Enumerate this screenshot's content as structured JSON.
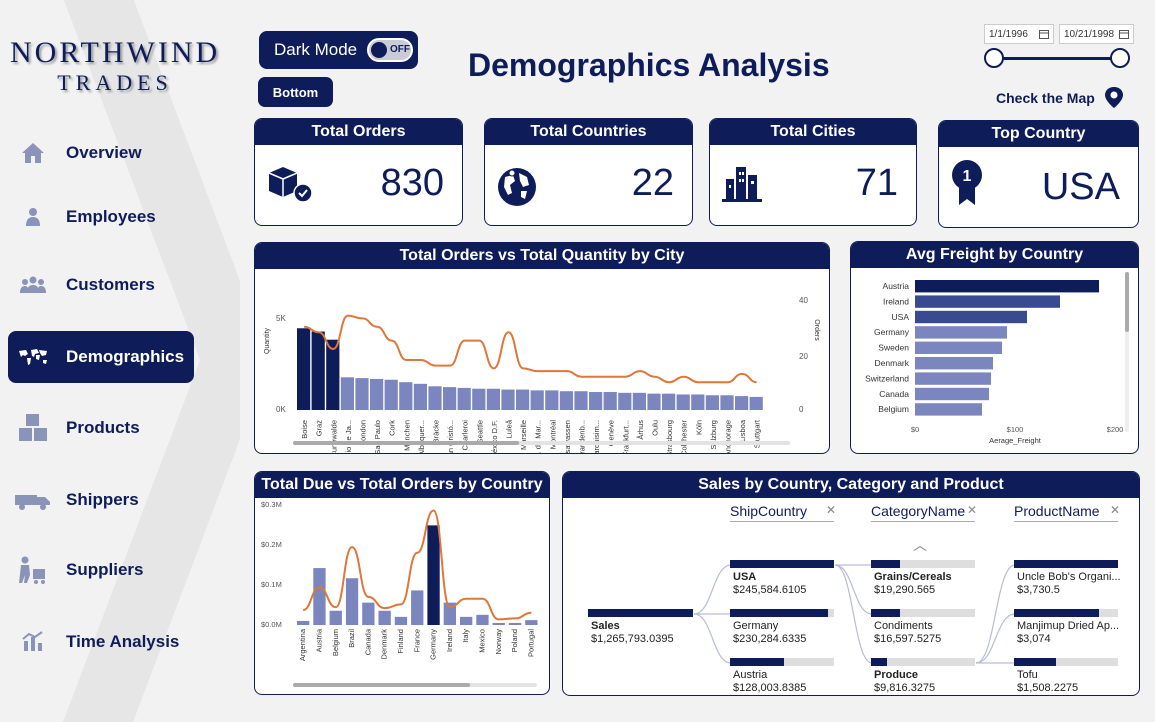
{
  "logo": {
    "line1": "NORTHWIND",
    "line2": "TRADES"
  },
  "nav": [
    {
      "label": "Overview",
      "icon": "home-icon"
    },
    {
      "label": "Employees",
      "icon": "person-icon"
    },
    {
      "label": "Customers",
      "icon": "group-icon"
    },
    {
      "label": "Demographics",
      "icon": "world-map-icon",
      "active": true
    },
    {
      "label": "Products",
      "icon": "boxes-icon"
    },
    {
      "label": "Shippers",
      "icon": "truck-icon"
    },
    {
      "label": "Suppliers",
      "icon": "supplier-icon"
    },
    {
      "label": "Time Analysis",
      "icon": "time-chart-icon"
    }
  ],
  "header": {
    "dark_mode_label": "Dark Mode",
    "toggle_state": "OFF",
    "bottom_label": "Bottom",
    "title": "Demographics Analysis",
    "date_from": "1/1/1996",
    "date_to": "10/21/1998",
    "map_link": "Check the Map"
  },
  "kpis": {
    "orders": {
      "label": "Total Orders",
      "value": "830"
    },
    "countries": {
      "label": "Total Countries",
      "value": "22"
    },
    "cities": {
      "label": "Total Cities",
      "value": "71"
    },
    "top_country": {
      "label": "Top Country",
      "value": "USA"
    }
  },
  "colors": {
    "navy": "#0f1c5a",
    "bar_light": "#7b86bf",
    "line": "#e0763a"
  },
  "chart_data": [
    {
      "type": "bar",
      "title": "Total Orders vs Total Quantity by City",
      "ylabel": "Quantity",
      "y2label": "Orders",
      "yticks": [
        "5K",
        "0K"
      ],
      "y2ticks": [
        "40",
        "20",
        "0"
      ],
      "categories": [
        "Boise",
        "Graz",
        "Cunewalde",
        "Rio de Ja...",
        "London",
        "Sao Paulo",
        "Cork",
        "München",
        "Albuquer...",
        "Bräcke",
        "San Cristó...",
        "Charleroi",
        "Seattle",
        "México D.F.",
        "Luleå",
        "Marseille",
        "I. de Mar...",
        "Montréal",
        "Tsawassen",
        "Brandenb...",
        "Barquisim...",
        "Genève",
        "Frankfurt...",
        "Århus",
        "Oulu",
        "Strasbourg",
        "Colchester",
        "Köln",
        "Salzburg",
        "Anchorage",
        "Lisboa",
        "Stuttgart"
      ],
      "series": [
        {
          "name": "Quantity",
          "values": [
            5000,
            4800,
            4300,
            2000,
            1950,
            1900,
            1850,
            1700,
            1600,
            1450,
            1400,
            1350,
            1300,
            1300,
            1250,
            1250,
            1200,
            1200,
            1150,
            1150,
            1100,
            1100,
            1050,
            1050,
            1000,
            1000,
            950,
            950,
            900,
            900,
            850,
            800
          ]
        },
        {
          "name": "Orders",
          "values": [
            30,
            28,
            22,
            34,
            33,
            30,
            25,
            18,
            18,
            16,
            16,
            25,
            25,
            15,
            28,
            15,
            14,
            14,
            14,
            12,
            12,
            12,
            12,
            14,
            12,
            10,
            12,
            10,
            10,
            10,
            13,
            10
          ]
        }
      ]
    },
    {
      "type": "bar",
      "title": "Avg Freight by Country",
      "xlabel": "Aerage_Freight",
      "xticks": [
        "$0",
        "$100",
        "$200"
      ],
      "categories": [
        "Austria",
        "Ireland",
        "USA",
        "Germany",
        "Sweden",
        "Denmark",
        "Switzerland",
        "Canada",
        "Belgium"
      ],
      "values": [
        184,
        145,
        112,
        92,
        87,
        78,
        76,
        74,
        67
      ],
      "xlim": [
        0,
        200
      ]
    },
    {
      "type": "bar",
      "title": "Total Due vs Total Orders by Country",
      "yticks": [
        "$0.3M",
        "$0.2M",
        "$0.1M",
        "$0.0M"
      ],
      "categories": [
        "Argentina",
        "Austria",
        "Belgium",
        "Brazil",
        "Canada",
        "Denmark",
        "Finland",
        "France",
        "Germany",
        "Ireland",
        "Italy",
        "Mexico",
        "Norway",
        "Poland",
        "Portugal"
      ],
      "series": [
        {
          "name": "Total Due",
          "values": [
            0.01,
            0.14,
            0.035,
            0.115,
            0.055,
            0.035,
            0.02,
            0.085,
            0.245,
            0.055,
            0.02,
            0.025,
            0.005,
            0.005,
            0.012
          ]
        },
        {
          "name": "Total Orders",
          "values": [
            16,
            40,
            19,
            83,
            30,
            18,
            22,
            77,
            122,
            19,
            28,
            28,
            6,
            7,
            13
          ]
        }
      ],
      "ylim": [
        0,
        0.3
      ]
    }
  ],
  "sankey": {
    "title": "Sales by Country, Category and Product",
    "headers": [
      "ShipCountry",
      "CategoryName",
      "ProductName"
    ],
    "root": {
      "label": "Sales",
      "value": "$1,265,793.0395"
    },
    "countries": [
      {
        "label": "USA",
        "value": "$245,584.6105",
        "fill": 1.0
      },
      {
        "label": "Germany",
        "value": "$230,284.6335",
        "fill": 0.94
      },
      {
        "label": "Austria",
        "value": "$128,003.8385",
        "fill": 0.52
      }
    ],
    "categories": [
      {
        "label": "Grains/Cereals",
        "value": "$19,290.565",
        "fill": 0.28
      },
      {
        "label": "Condiments",
        "value": "$16,597.5275",
        "fill": 0.28
      },
      {
        "label": "Produce",
        "value": "$9,816.3275",
        "fill": 0.15
      }
    ],
    "products": [
      {
        "label": "Uncle Bob's Organi...",
        "value": "$3,730.5",
        "fill": 1.0
      },
      {
        "label": "Manjimup Dried Ap...",
        "value": "$3,074",
        "fill": 0.82
      },
      {
        "label": "Tofu",
        "value": "$1,508.2275",
        "fill": 0.4
      }
    ]
  }
}
